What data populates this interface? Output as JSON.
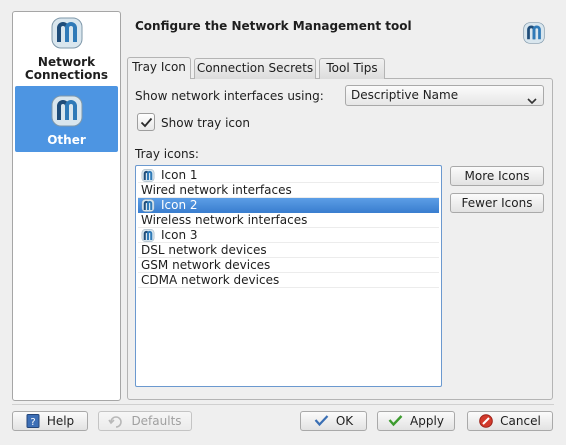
{
  "sidebar": {
    "items": [
      {
        "label_line1": "Network",
        "label_line2": "Connections",
        "icon": "network-manager-icon",
        "selected": false
      },
      {
        "label": "Other",
        "icon": "network-manager-icon",
        "selected": true
      }
    ]
  },
  "header": {
    "title": "Configure the Network Management tool",
    "icon": "network-manager-icon"
  },
  "tabs": [
    {
      "label": "Tray Icon",
      "active": true
    },
    {
      "label": "Connection Secrets",
      "active": false
    },
    {
      "label": "Tool Tips",
      "active": false
    }
  ],
  "form": {
    "interfaces_label": "Show network interfaces using:",
    "interfaces_value": "Descriptive Name",
    "show_tray_label": "Show tray icon",
    "show_tray_checked": true,
    "tray_icons_label": "Tray icons:"
  },
  "tray_list": [
    {
      "label": "Icon 1",
      "type": "icon"
    },
    {
      "label": "Wired network interfaces",
      "type": "item"
    },
    {
      "label": "Icon 2",
      "type": "icon",
      "selected": true
    },
    {
      "label": "Wireless network interfaces",
      "type": "item"
    },
    {
      "label": "Icon 3",
      "type": "icon"
    },
    {
      "label": "DSL network devices",
      "type": "item"
    },
    {
      "label": "GSM network devices",
      "type": "item"
    },
    {
      "label": "CDMA network devices",
      "type": "item"
    }
  ],
  "side_buttons": {
    "more": "More Icons",
    "fewer": "Fewer Icons"
  },
  "footer": {
    "help": "Help",
    "defaults": "Defaults",
    "ok": "OK",
    "apply": "Apply",
    "cancel": "Cancel"
  },
  "colors": {
    "selection": "#4d95e2",
    "list_border": "#6b99cf"
  }
}
